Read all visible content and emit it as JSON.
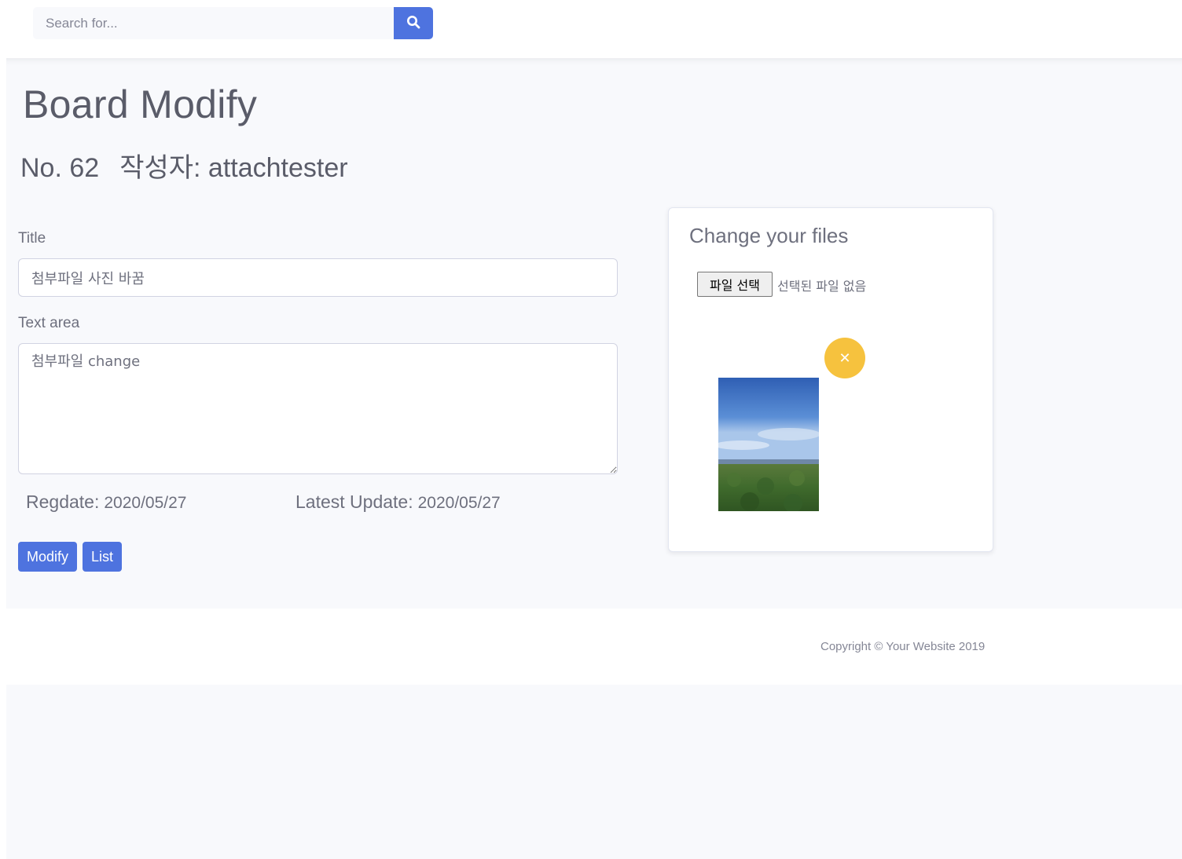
{
  "search": {
    "placeholder": "Search for...",
    "icon": "search-icon"
  },
  "page": {
    "title": "Board Modify",
    "number": "No. 62",
    "writer": "작성자: attachtester"
  },
  "form": {
    "title_label": "Title",
    "title_value": "첨부파일 사진 바꿈",
    "textarea_label": "Text area",
    "textarea_value": "첨부파일 change",
    "regdate_label": "Regdate:",
    "regdate_value": "2020/05/27",
    "update_label": "Latest Update:",
    "update_value": "2020/05/27",
    "modify_button": "Modify",
    "list_button": "List"
  },
  "files": {
    "card_title": "Change your files",
    "choose_button": "파일 선택",
    "status_text": "선택된 파일 없음",
    "remove_icon": "close-icon",
    "thumbnail": "landscape-photo"
  },
  "footer": {
    "copyright": "Copyright © Your Website 2019"
  },
  "colors": {
    "primary": "#4e73df",
    "warning": "#f6c23e",
    "background": "#f8f9fc",
    "text": "#6e707e"
  }
}
